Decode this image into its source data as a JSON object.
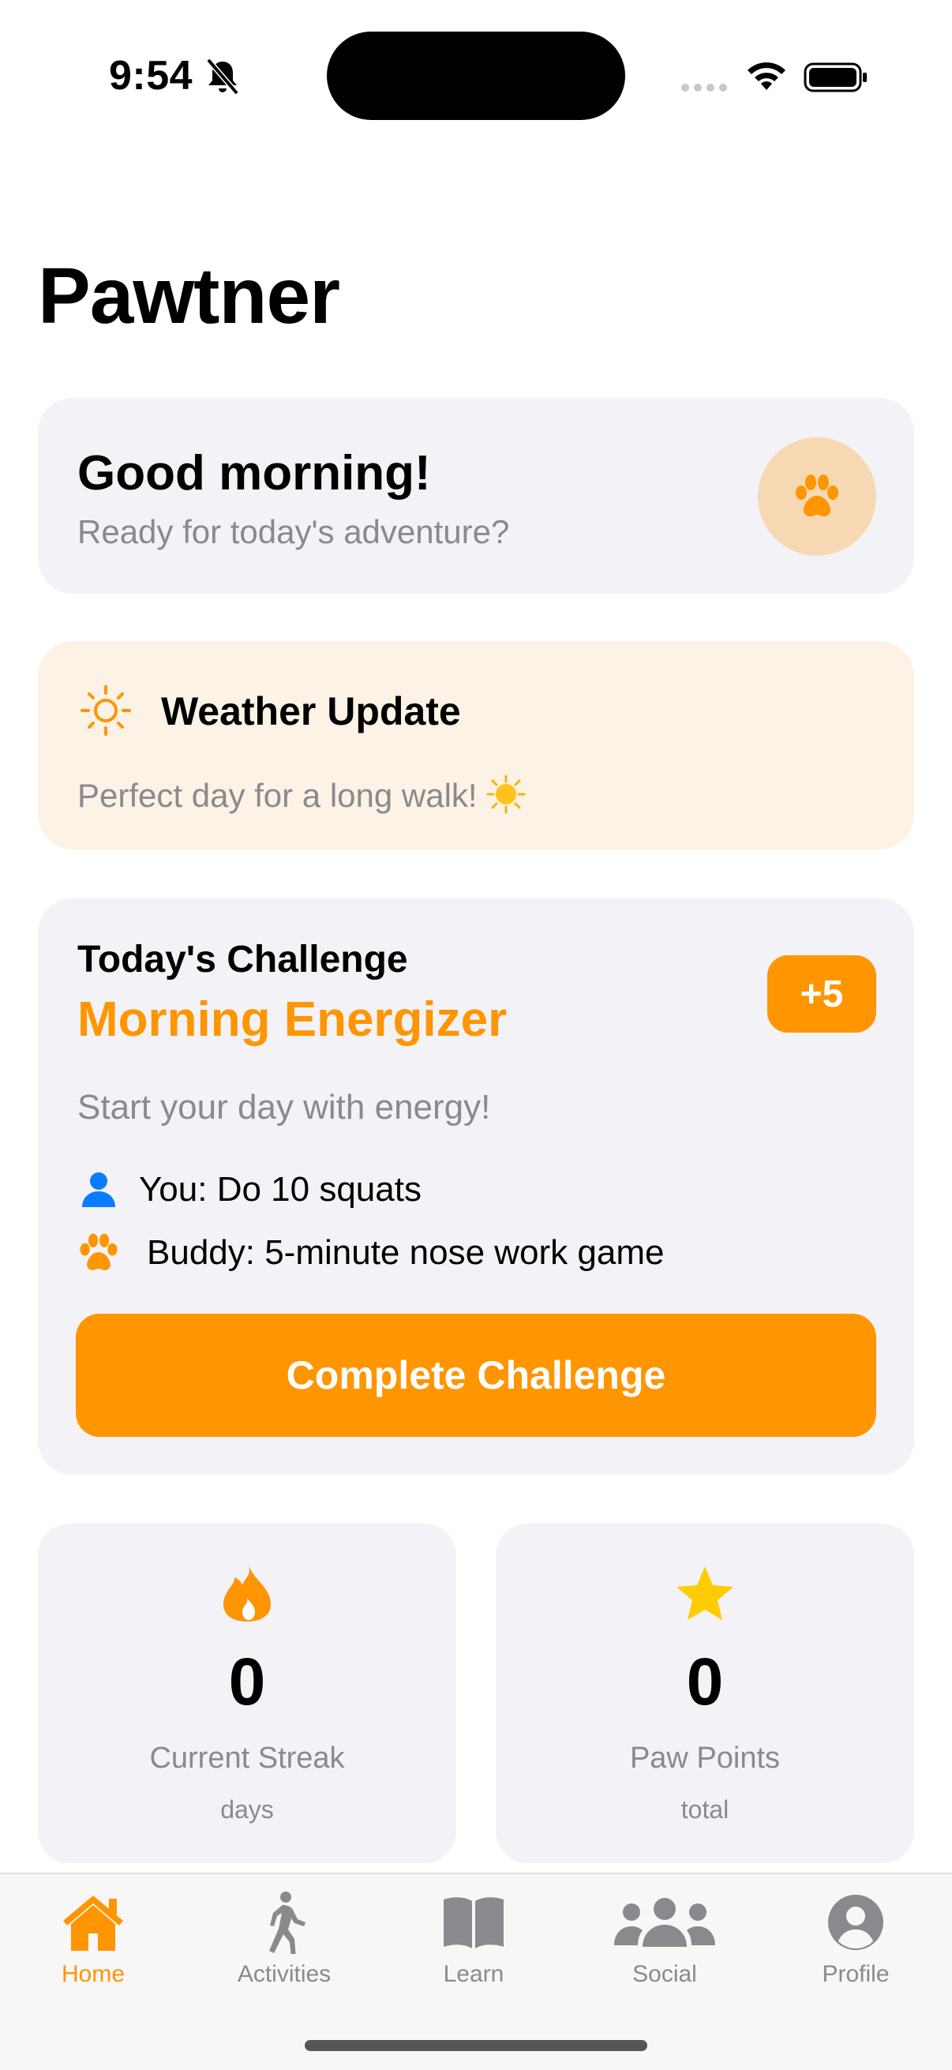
{
  "status_bar": {
    "time": "9:54"
  },
  "app": {
    "title": "Pawtner"
  },
  "greeting": {
    "title": "Good morning!",
    "subtitle": "Ready for today's adventure?",
    "icon": "paw-icon"
  },
  "weather": {
    "title": "Weather Update",
    "message": "Perfect day for a long walk!",
    "icon": "sun-icon",
    "emoji_icon": "sun-emoji-icon"
  },
  "challenge": {
    "heading": "Today's Challenge",
    "name": "Morning Energizer",
    "points_badge": "+5",
    "description": "Start your day with energy!",
    "you_task": "You: Do 10 squats",
    "buddy_task": "Buddy: 5-minute nose work game",
    "button_label": "Complete Challenge"
  },
  "stats": {
    "streak": {
      "value": "0",
      "label": "Current Streak",
      "unit": "days",
      "icon": "flame-icon"
    },
    "points": {
      "value": "0",
      "label": "Paw Points",
      "unit": "total",
      "icon": "star-icon"
    }
  },
  "tabs": [
    {
      "label": "Home",
      "icon": "house-icon",
      "active": true
    },
    {
      "label": "Activities",
      "icon": "walking-figure-icon",
      "active": false
    },
    {
      "label": "Learn",
      "icon": "book-icon",
      "active": false
    },
    {
      "label": "Social",
      "icon": "people-icon",
      "active": false
    },
    {
      "label": "Profile",
      "icon": "person-circle-icon",
      "active": false
    }
  ],
  "colors": {
    "accent": "#ff9500",
    "card": "#f2f2f7",
    "weather_card": "#fdf2e6",
    "secondary_text": "#8a8a8e",
    "you_icon": "#0a7cff",
    "star": "#ffcc00"
  }
}
